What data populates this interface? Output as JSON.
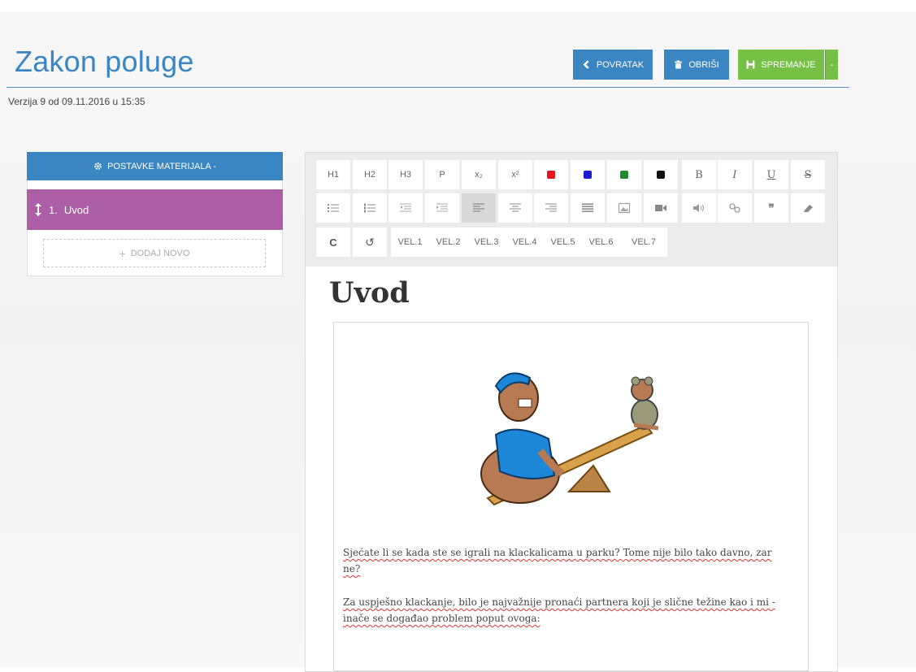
{
  "header": {
    "title": "Zakon poluge",
    "version": "Verzija 9 od 09.11.2016 u 15:35",
    "back_label": "POVRATAK",
    "delete_label": "OBRIŠI",
    "save_label": "SPREMANJE",
    "save_caret": "-"
  },
  "sidebar": {
    "settings_label": "POSTAVKE MATERIJALA -",
    "items": [
      {
        "number": "1.",
        "label": "Uvod"
      }
    ],
    "add_label": "DODAJ NOVO"
  },
  "toolbar": {
    "row1": [
      "H1",
      "H2",
      "H3",
      "P",
      "x₂",
      "x²"
    ],
    "colors": [
      "#e8141e",
      "#1a1ad6",
      "#1f8a2c",
      "#111111"
    ],
    "format": [
      "B",
      "I",
      "U",
      "S"
    ],
    "row3_undo": "C",
    "row3_redo": "↺",
    "sizes": [
      "VEL.1",
      "VEL.2",
      "VEL.3",
      "VEL.4",
      "VEL.5",
      "VEL.6",
      "VEL.7"
    ]
  },
  "document": {
    "heading": "Uvod",
    "paragraphs": [
      "Sjećate li se kada ste se igrali na klackalicama u parku? Tome nije bilo tako davno, zar ne?",
      "Za uspješno klackanje, bilo je najvažnije pronaći partnera koji je slične težine kao i mi - inače se događao problem poput ovoga:"
    ]
  },
  "colors": {
    "primary": "#3a86c2",
    "success": "#76c045",
    "active_item": "#ad5fa5"
  }
}
